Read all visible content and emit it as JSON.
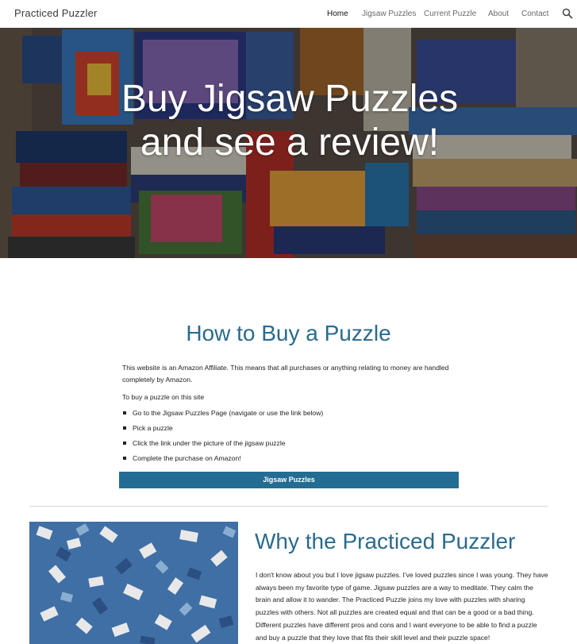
{
  "header": {
    "site_title": "Practiced Puzzler",
    "nav": [
      {
        "label": "Home",
        "active": true
      },
      {
        "label": "Jigsaw Puzzles",
        "active": false
      },
      {
        "label": "Current Puzzle",
        "active": false
      },
      {
        "label": "About",
        "active": false
      },
      {
        "label": "Contact",
        "active": false
      }
    ],
    "search_icon": "search-icon"
  },
  "hero": {
    "title": "Buy Jigsaw Puzzles and see a review!"
  },
  "buy_section": {
    "heading": "How to Buy a Puzzle",
    "intro": "This website is an Amazon Affiliate. This means that all purchases or anything relating to money are handled completely by Amazon.",
    "subheading": "To buy a puzzle on this site",
    "steps": [
      "Go to the Jigsaw Puzzles Page (navigate or use the link below)",
      "Pick a puzzle",
      "Click the link under the picture of the jigsaw puzzle",
      "Complete the purchase on Amazon!"
    ],
    "button_label": "Jigsaw Puzzles"
  },
  "why_section": {
    "heading": "Why the Practiced Puzzler",
    "body": "I don't know about you but I love jigsaw puzzles. I've loved puzzles since I was young. They have always been my favorite type of game. Jigsaw puzzles are a way to meditate. They calm the brain and allow it to wander. The Practiced Puzzle joins my love with puzzles with sharing puzzles with others. Not all puzzles are created equal and that can be a good or a bad thing. Different puzzles have different pros and cons and I want everyone to be able to find a puzzle and buy a puzzle that they love that fits their skill level and their puzzle space!"
  },
  "colors": {
    "accent": "#2a6b8c",
    "button": "#236d92",
    "divider": "#d6d6d6"
  }
}
